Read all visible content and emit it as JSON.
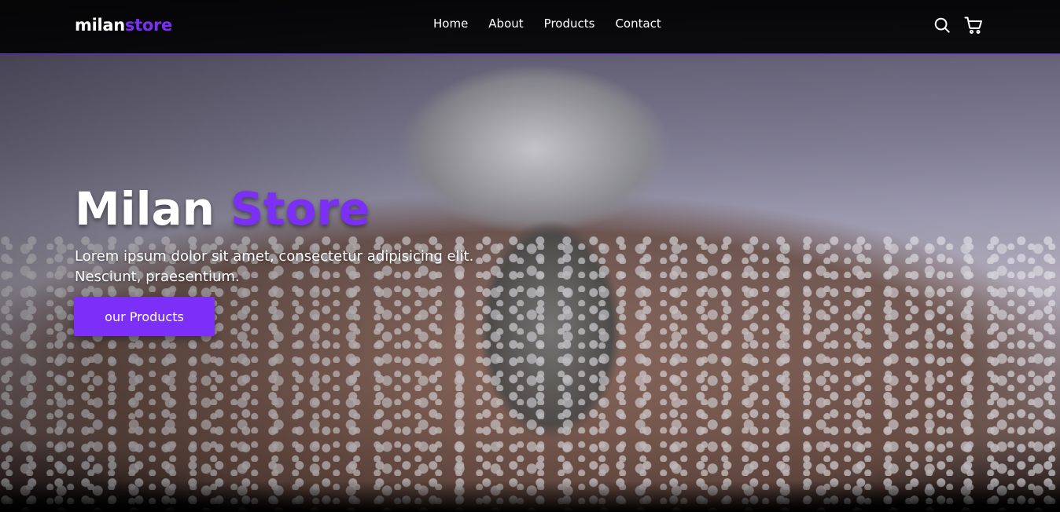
{
  "brand": {
    "name": "milan",
    "accent_name": "store",
    "accent_color": "#7b2ff7"
  },
  "nav": {
    "links": [
      "Home",
      "About",
      "Products",
      "Contact"
    ],
    "icons": [
      "search-icon",
      "cart-icon"
    ]
  },
  "hero": {
    "title_main": "Milan ",
    "title_accent": "Store",
    "subtitle": "Lorem ipsum dolor sit amet, consectetur adipisicing elit. Nesciunt, praesentium.",
    "cta_label": "our Products",
    "background_image": "snow-covered-monkey-head-sculpture"
  },
  "colors": {
    "accent": "#7b2ff7",
    "text": "#ffffff",
    "navbar_bg": "#000000"
  }
}
